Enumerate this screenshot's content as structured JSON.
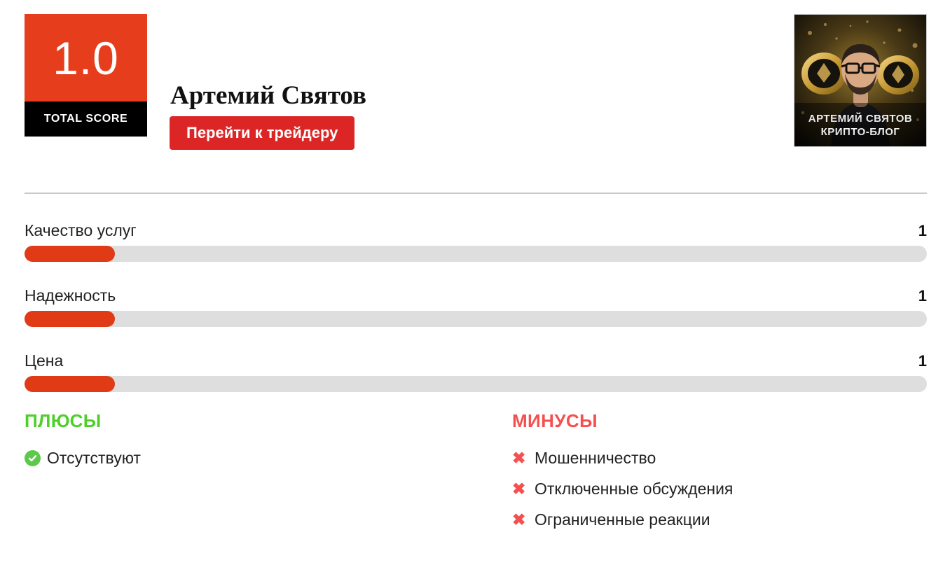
{
  "header": {
    "score": {
      "value": "1.0",
      "caption": "TOTAL SCORE",
      "bg_color": "#e63e1c",
      "caption_bg_color": "#000000"
    },
    "trader_name": "Артемий Святов",
    "cta_label": "Перейти к трейдеру",
    "cta_color": "#dc2626",
    "avatar": {
      "name_line1": "АРТЕМИЙ СВЯТОВ",
      "name_line2": "КРИПТО-БЛОГ",
      "alt": "Артемий Святов крипто-блог аватар"
    }
  },
  "ratings": {
    "max": 10,
    "fill_color": "#e13a17",
    "track_color": "#dedede",
    "items": [
      {
        "label": "Качество услуг",
        "value": "1",
        "percent": 10
      },
      {
        "label": "Надежность",
        "value": "1",
        "percent": 10
      },
      {
        "label": "Цена",
        "value": "1",
        "percent": 10
      }
    ]
  },
  "pros": {
    "heading": "ПЛЮСЫ",
    "heading_color": "#4ecf2a",
    "items": [
      {
        "text": "Отсутствуют"
      }
    ]
  },
  "cons": {
    "heading": "МИНУСЫ",
    "heading_color": "#f5504f",
    "items": [
      {
        "text": "Мошенничество"
      },
      {
        "text": "Отключенные обсуждения"
      },
      {
        "text": "Ограниченные реакции"
      }
    ]
  }
}
